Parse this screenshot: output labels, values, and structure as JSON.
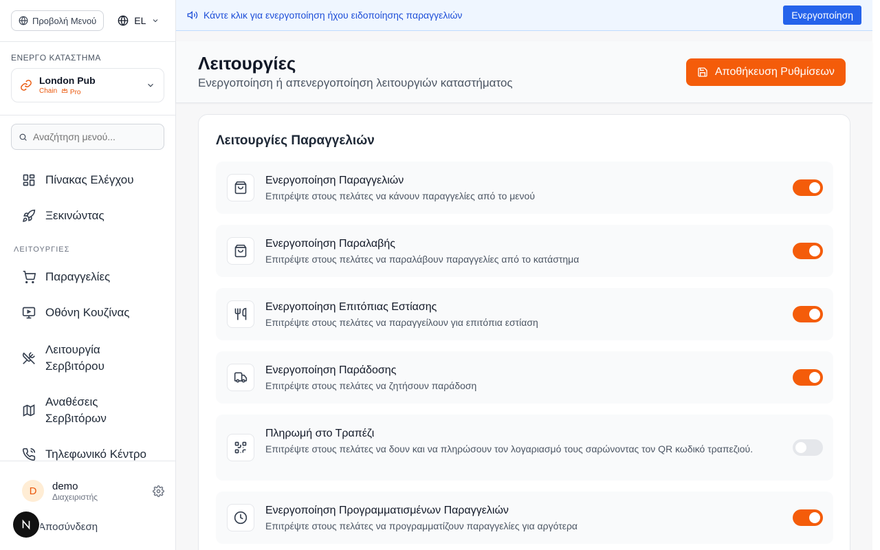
{
  "sidebar": {
    "menu_view_button": "Προβολή Μενού",
    "language": "EL",
    "active_store_label": "ΕΝΕΡΓΟ ΚΑΤΑΣΤΗΜΑ",
    "store": {
      "name": "London Pub",
      "tag_chain": "Chain",
      "tag_pro": "Pro"
    },
    "search_placeholder": "Αναζήτηση μενού...",
    "nav_top": [
      {
        "label": "Πίνακας Ελέγχου",
        "icon": "dashboard-icon"
      },
      {
        "label": "Ξεκινώντας",
        "icon": "rocket-icon"
      }
    ],
    "section_label": "ΛΕΙΤΟΥΡΓΙΕΣ",
    "nav_features": [
      {
        "label": "Παραγγελίες",
        "icon": "cart-icon"
      },
      {
        "label": "Οθόνη Κουζίνας",
        "icon": "monitor-icon"
      },
      {
        "label": "Λειτουργία Σερβιτόρου",
        "icon": "utensils-crossed-icon"
      },
      {
        "label": "Αναθέσεις Σερβιτόρων",
        "icon": "map-icon"
      },
      {
        "label": "Τηλεφωνικό Κέντρο",
        "icon": "phone-icon"
      }
    ],
    "user": {
      "initial": "D",
      "name": "demo",
      "role": "Διαχειριστής"
    },
    "logout": "Αποσύνδεση",
    "badge_letter": "N"
  },
  "banner": {
    "text": "Κάντε κλικ για ενεργοποίηση ήχου ειδοποίησης παραγγελιών",
    "button": "Ενεργοποίηση"
  },
  "header": {
    "title": "Λειτουργίες",
    "subtitle": "Ενεργοποίηση ή απενεργοποίηση λειτουργιών καταστήματος",
    "save_button": "Αποθήκευση Ρυθμίσεων"
  },
  "card": {
    "title": "Λειτουργίες Παραγγελιών",
    "features": [
      {
        "title": "Ενεργοποίηση Παραγγελιών",
        "desc": "Επιτρέψτε στους πελάτες να κάνουν παραγγελίες από το μενού",
        "enabled": true,
        "icon": "shopping-bag-icon"
      },
      {
        "title": "Ενεργοποίηση Παραλαβής",
        "desc": "Επιτρέψτε στους πελάτες να παραλάβουν παραγγελίες από το κατάστημα",
        "enabled": true,
        "icon": "shopping-bag-icon"
      },
      {
        "title": "Ενεργοποίηση Επιτόπιας Εστίασης",
        "desc": "Επιτρέψτε στους πελάτες να παραγγείλουν για επιτόπια εστίαση",
        "enabled": true,
        "icon": "utensils-icon"
      },
      {
        "title": "Ενεργοποίηση Παράδοσης",
        "desc": "Επιτρέψτε στους πελάτες να ζητήσουν παράδοση",
        "enabled": true,
        "icon": "truck-icon"
      },
      {
        "title": "Πληρωμή στο Τραπέζι",
        "desc": "Επιτρέψτε στους πελάτες να δουν και να πληρώσουν τον λογαριασμό τους σαρώνοντας τον QR κωδικό τραπεζιού.",
        "enabled": false,
        "icon": "qr-code-icon"
      },
      {
        "title": "Ενεργοποίηση Προγραμματισμένων Παραγγελιών",
        "desc": "Επιτρέψτε στους πελάτες να προγραμματίζουν παραγγελίες για αργότερα",
        "enabled": true,
        "icon": "clock-icon"
      }
    ]
  },
  "colors": {
    "accent": "#f45c0a",
    "banner_blue": "#2563eb",
    "toggle_off": "#e5e7eb"
  }
}
